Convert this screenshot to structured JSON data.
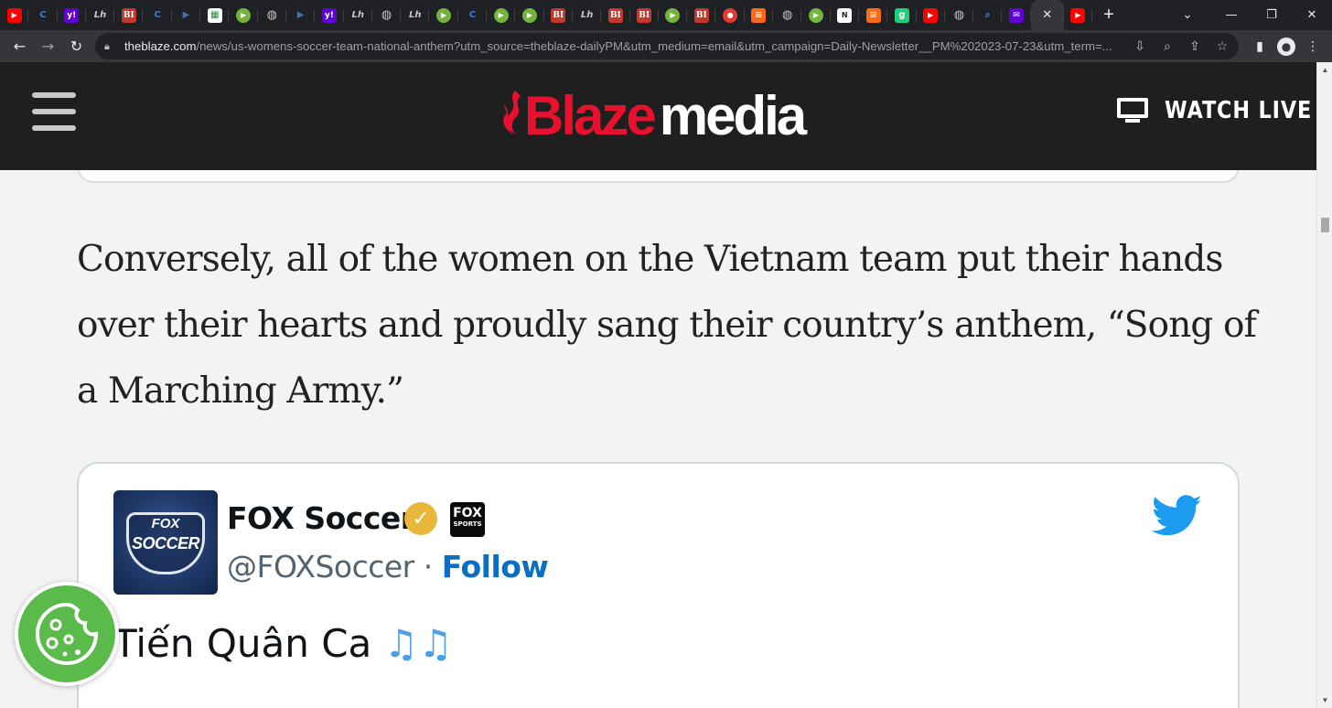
{
  "browser": {
    "tabs": [
      {
        "icon": "youtube-icon",
        "glyph": "▶",
        "color": "#ff0000"
      },
      {
        "icon": "shield-c-icon",
        "glyph": "C",
        "color": "#3a7bd5"
      },
      {
        "icon": "yahoo-icon",
        "glyph": "y!",
        "color": "#6001d2"
      },
      {
        "icon": "wsj-icon",
        "glyph": "Lh",
        "color": "#555555"
      },
      {
        "icon": "business-insider-icon",
        "glyph": "BI",
        "color": "#c0392b"
      },
      {
        "icon": "shield-c-icon",
        "glyph": "C",
        "color": "#3a7bd5"
      },
      {
        "icon": "bookmark-arrow-icon",
        "glyph": "▶",
        "color": "#4a6fa5"
      },
      {
        "icon": "sheets-icon",
        "glyph": "▦",
        "color": "#ffffff"
      },
      {
        "icon": "rumble-icon",
        "glyph": "▶",
        "color": "#74b43d"
      },
      {
        "icon": "globe-icon",
        "glyph": "◍",
        "color": "#9aa0a6"
      },
      {
        "icon": "bookmark-arrow-icon",
        "glyph": "▶",
        "color": "#4a6fa5"
      },
      {
        "icon": "yahoo-icon",
        "glyph": "y!",
        "color": "#6001d2"
      },
      {
        "icon": "wsj-icon",
        "glyph": "Lh",
        "color": "#555555"
      },
      {
        "icon": "globe-icon",
        "glyph": "◍",
        "color": "#9aa0a6"
      },
      {
        "icon": "wsj-icon",
        "glyph": "Lh",
        "color": "#555555"
      },
      {
        "icon": "rumble-icon",
        "glyph": "▶",
        "color": "#74b43d"
      },
      {
        "icon": "shield-c-icon",
        "glyph": "C",
        "color": "#3a7bd5"
      },
      {
        "icon": "rumble-icon",
        "glyph": "▶",
        "color": "#74b43d"
      },
      {
        "icon": "rumble-icon",
        "glyph": "▶",
        "color": "#74b43d"
      },
      {
        "icon": "business-insider-icon",
        "glyph": "BI",
        "color": "#c0392b"
      },
      {
        "icon": "wsj-icon",
        "glyph": "Lh",
        "color": "#555555"
      },
      {
        "icon": "business-insider-icon",
        "glyph": "BI",
        "color": "#c0392b"
      },
      {
        "icon": "business-insider-icon",
        "glyph": "BI",
        "color": "#c0392b"
      },
      {
        "icon": "rumble-icon",
        "glyph": "▶",
        "color": "#74b43d"
      },
      {
        "icon": "business-insider-icon",
        "glyph": "BI",
        "color": "#c0392b"
      },
      {
        "icon": "microphone-icon",
        "glyph": "●",
        "color": "#e53935"
      },
      {
        "icon": "substack-icon",
        "glyph": "≡",
        "color": "#ff6719"
      },
      {
        "icon": "globe-icon",
        "glyph": "◍",
        "color": "#9aa0a6"
      },
      {
        "icon": "rumble-icon",
        "glyph": "▶",
        "color": "#74b43d"
      },
      {
        "icon": "news-icon",
        "glyph": "N",
        "color": "#666666"
      },
      {
        "icon": "substack-icon",
        "glyph": "≡",
        "color": "#ff6719"
      },
      {
        "icon": "gab-icon",
        "glyph": "g",
        "color": "#21cf7a"
      },
      {
        "icon": "youtube-icon",
        "glyph": "▶",
        "color": "#ff0000"
      },
      {
        "icon": "globe-icon",
        "glyph": "◍",
        "color": "#9aa0a6"
      },
      {
        "icon": "search-icon",
        "glyph": "⌕",
        "color": "#4285f4"
      },
      {
        "icon": "mail-icon",
        "glyph": "✉",
        "color": "#6001d2"
      }
    ],
    "active_tab_close": "✕",
    "trailing_tab": {
      "icon": "youtube-icon",
      "glyph": "▶",
      "color": "#ff0000"
    },
    "new_tab": "+",
    "url_host": "theblaze.com",
    "url_path": "/news/us-womens-soccer-team-national-anthem?utm_source=theblaze-dailyPM&utm_medium=email&utm_campaign=Daily-Newsletter__PM%202023-07-23&utm_term=..."
  },
  "site": {
    "logo_blaze": "Blaze",
    "logo_media": "media",
    "logo_color": "#e8112d",
    "watch_live": "WATCH LIVE"
  },
  "article": {
    "paragraph": "Conversely, all of the women on the Vietnam team put their hands over their hearts and proudly sang their country’s anthem, “Song of a Marching Army.”"
  },
  "tweet": {
    "author_name": "FOX Soccer",
    "handle": "@FOXSoccer",
    "separator": "·",
    "follow_label": "Follow",
    "affiliate_badge_line1": "FOX",
    "affiliate_badge_line2": "SPORTS",
    "avatar_text_top": "FOX",
    "avatar_text_main": "SOCCER",
    "text": "Tiến Quân Ca",
    "text_emoji": "♫♫",
    "twitter_blue": "#1d9bf0",
    "verified_color": "#e9b73b"
  },
  "cookie_button": {
    "icon": "cookie-icon",
    "color": "#5aba4a"
  }
}
